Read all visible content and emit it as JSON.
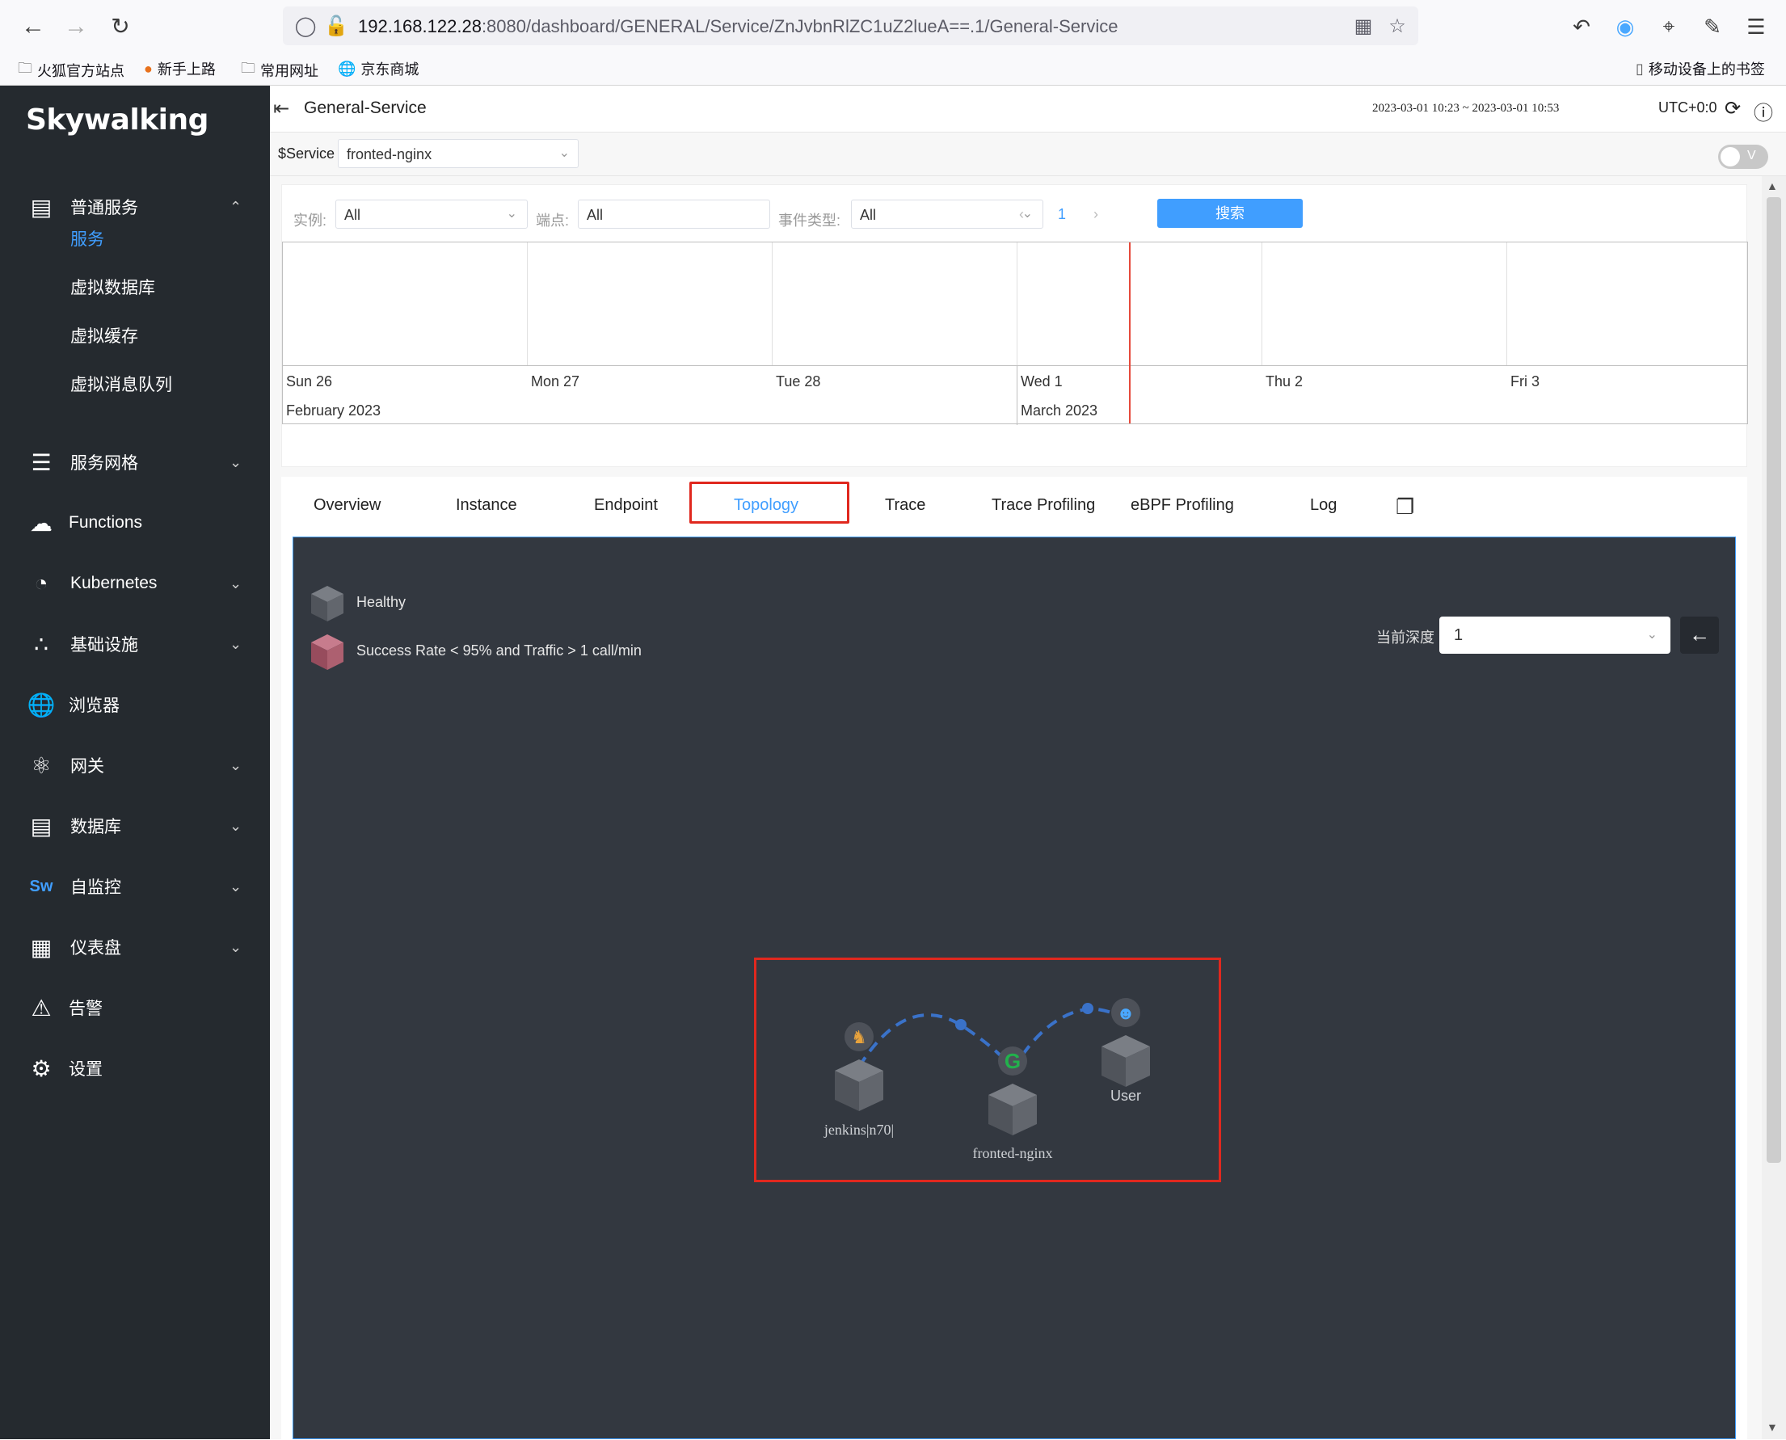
{
  "browser": {
    "url_host": "192.168.122.28",
    "url_rest": ":8080/dashboard/GENERAL/Service/ZnJvbnRlZC1uZ2lueA==.1/General-Service",
    "bookmarks": [
      "火狐官方站点",
      "新手上路",
      "常用网址",
      "京东商城"
    ],
    "mobile_bookmarks": "移动设备上的书签"
  },
  "sidebar": {
    "logo": "Skywalking",
    "menu": [
      {
        "label": "普通服务",
        "icon": "chart-icon",
        "expanded": true
      },
      {
        "label": "服务网格",
        "icon": "stack-icon"
      },
      {
        "label": "Functions",
        "icon": "cloud-icon"
      },
      {
        "label": "Kubernetes",
        "icon": "pie-icon"
      },
      {
        "label": "基础设施",
        "icon": "dots-icon"
      },
      {
        "label": "浏览器",
        "icon": "globe-icon"
      },
      {
        "label": "网关",
        "icon": "gateway-icon"
      },
      {
        "label": "数据库",
        "icon": "database-icon"
      },
      {
        "label": "自监控",
        "icon": "sw-icon"
      },
      {
        "label": "仪表盘",
        "icon": "dashboard-icon"
      },
      {
        "label": "告警",
        "icon": "alert-icon"
      },
      {
        "label": "设置",
        "icon": "gear-icon"
      }
    ],
    "submenu": [
      "服务",
      "虚拟数据库",
      "虚拟缓存",
      "虚拟消息队列"
    ]
  },
  "header": {
    "title": "General-Service",
    "time_range": "2023-03-01 10:23 ~ 2023-03-01 10:53",
    "timezone": "UTC+0:0"
  },
  "service_bar": {
    "label": "$Service",
    "selected": "fronted-nginx",
    "toggle_label": "V"
  },
  "event_filters": {
    "instance_label": "实例:",
    "instance_value": "All",
    "endpoint_label": "端点:",
    "endpoint_value": "All",
    "event_type_label": "事件类型:",
    "event_type_value": "All",
    "page": "1",
    "search_label": "搜索"
  },
  "timeline": {
    "days": [
      "Sun 26",
      "Mon 27",
      "Tue 28",
      "Wed 1",
      "Thu 2",
      "Fri 3"
    ],
    "months": [
      "February 2023",
      "March 2023"
    ]
  },
  "tabs": [
    "Overview",
    "Instance",
    "Endpoint",
    "Topology",
    "Trace",
    "Trace Profiling",
    "eBPF Profiling",
    "Log"
  ],
  "active_tab": "Topology",
  "topology": {
    "legend_healthy": "Healthy",
    "legend_unhealthy": "Success Rate < 95% and Traffic > 1 call/min",
    "depth_label": "当前深度",
    "depth_value": "1",
    "nodes": [
      {
        "name": "jenkins|n70|",
        "icon": "jenkins-icon"
      },
      {
        "name": "fronted-nginx",
        "icon": "nginx-icon"
      },
      {
        "name": "User",
        "icon": "users-icon"
      }
    ],
    "colors": {
      "background": "#333840",
      "edge": "#3a72c9",
      "healthy": "#5b5f66",
      "unhealthy": "#b05a6e",
      "accent": "#409eff",
      "highlight": "#e0281e"
    }
  }
}
